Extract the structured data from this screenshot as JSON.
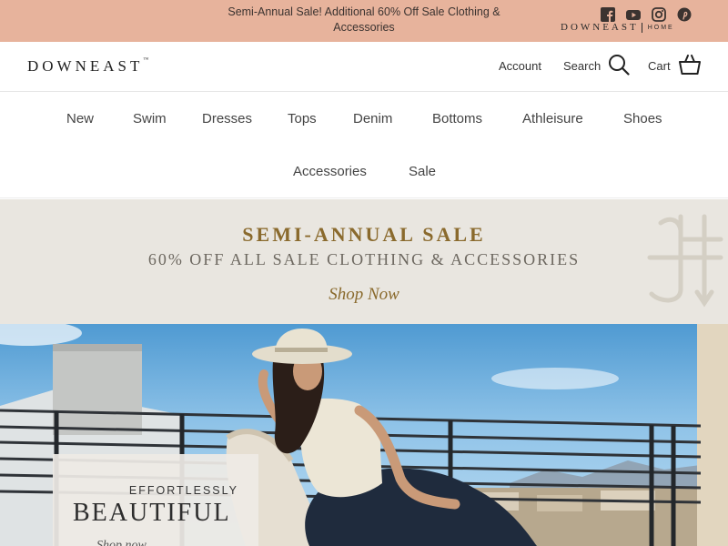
{
  "announcement": {
    "text": "Semi-Annual Sale! Additional 60% Off Sale Clothing & Accessories",
    "social_icons": [
      "facebook-icon",
      "youtube-icon",
      "instagram-icon",
      "pinterest-icon"
    ],
    "sister_brand": {
      "name": "DOWNEAST",
      "sub": "HOME"
    },
    "background": "#e7b39c"
  },
  "header": {
    "logo": "DOWNEAST",
    "account": "Account",
    "search": "Search",
    "cart": "Cart"
  },
  "nav": {
    "items": [
      "New",
      "Swim",
      "Dresses",
      "Tops",
      "Denim",
      "Bottoms",
      "Athleisure",
      "Shoes",
      "Accessories",
      "Sale"
    ]
  },
  "promo": {
    "title": "SEMI-ANNUAL SALE",
    "subtitle": "60% OFF ALL SALE CLOTHING & ACCESSORIES",
    "cta": "Shop Now",
    "accent": "#8a6a2d",
    "background": "#e9e6e0"
  },
  "hero": {
    "eyebrow": "EFFORTLESSLY",
    "title": "BEAUTIFUL",
    "cta": "Shop now"
  }
}
